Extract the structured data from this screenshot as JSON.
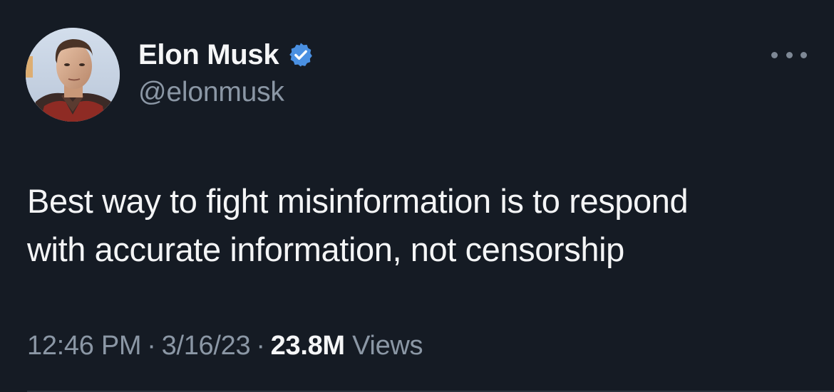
{
  "author": {
    "display_name": "Elon Musk",
    "handle": "@elonmusk",
    "verified_icon": "verified-badge-icon",
    "badge_color": "#4a90e2"
  },
  "tweet": {
    "text_lines": [
      "Best way to fight misinformation is to respond",
      "with accurate information, not censorship"
    ]
  },
  "meta": {
    "time": "12:46 PM",
    "separator": "·",
    "date": "3/16/23",
    "views_count": "23.8M",
    "views_label": "Views"
  },
  "theme": {
    "background": "#151b24",
    "primary_text": "#f4f5f6",
    "secondary_text": "#8b97a5"
  }
}
